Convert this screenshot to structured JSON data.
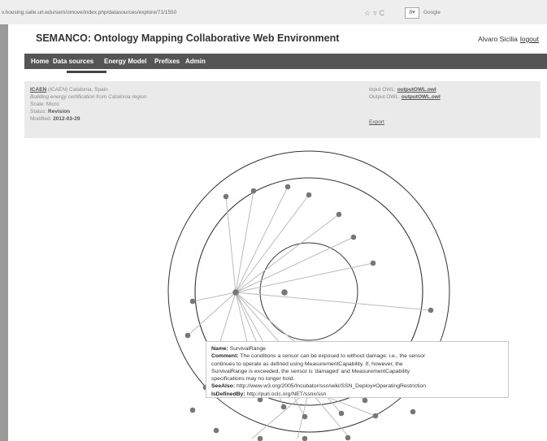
{
  "browser": {
    "url": "v.housing.salle.url.edu/sem/omove/index.php/datasources/explore/71/1550",
    "search_placeholder": "Google"
  },
  "header": {
    "title": "SEMANCO: Ontology Mapping Collaborative Web Environment",
    "user_name": "Alvaro Sicilia",
    "logout_label": "logout"
  },
  "nav": {
    "items": [
      "Home",
      "Data sources",
      "Energy Model",
      "Prefixes",
      "Admin"
    ],
    "active": "Data sources"
  },
  "datasource": {
    "name_link": "ICAEN",
    "name_rest": "(ICAEN) Catalonia, Spain",
    "description": "Building energy certification from Catalonia region",
    "scale_label": "Scale:",
    "scale_value": "Micro",
    "status_label": "Status:",
    "status_value": "Revision",
    "modified_label": "Modified:",
    "modified_value": "2012-03-29",
    "input_owl_label": "Input OWL:",
    "input_owl_value": "outputOWL.owl",
    "output_owl_label": "Output OWL:",
    "output_owl_value": "outputOWL.owl",
    "export_label": "Export"
  },
  "tooltip": {
    "name_label": "Name:",
    "name_value": "SurvivalRange",
    "comment_label": "Comment:",
    "comment_line1": "The conditions a sensor can be exposed to without damage: i.e., the sensor",
    "comment_line2": "continues to operate as defined using MeasurementCapability. If, however, the",
    "comment_line3": "SurvivalRange is exceeded, the sensor is 'damaged' and MeasurementCapability",
    "comment_line4": "specifications may no longer hold.",
    "seealso_label": "SeeAlso:",
    "seealso_value": "http://www.w3.org/2005/Incubator/ssn/wiki/SSN_Deploy#OperatingRestriction",
    "isdefinedby_label": "IsDefinedBy:",
    "isdefinedby_value": "http://purl.oclc.org/NET/ssnx/ssn"
  },
  "colors": {
    "nav_background": "#555555",
    "info_background": "#eaeaea",
    "node": "#777777",
    "edge": "#bbbbbb",
    "circle": "#333333"
  }
}
